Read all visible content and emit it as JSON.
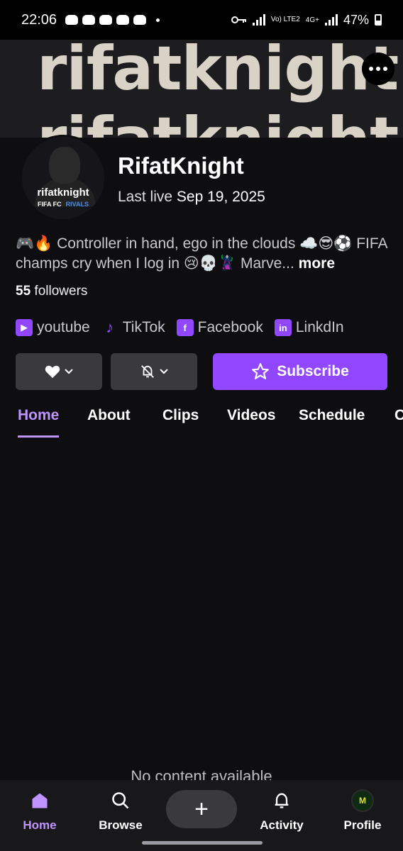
{
  "status_bar": {
    "time": "22:06",
    "network": "Vo) LTE2",
    "network2": "4G+",
    "battery": "47%"
  },
  "banner": {
    "text_top": "rifatknight",
    "text_bottom": "rifatknight"
  },
  "avatar": {
    "name": "rifatknight",
    "tag1": "FIFA FC",
    "tag2": "RIVALS"
  },
  "channel": {
    "name": "RifatKnight",
    "last_live_label": "Last live",
    "last_live_date": "Sep 19, 2025",
    "bio": "🎮🔥 Controller in hand, ego in the clouds ☁️😎⚽ FIFA champs cry when I log in 😢💀🦹 Marve...",
    "bio_more": "more",
    "followers_count": "55",
    "followers_label": "followers"
  },
  "socials": [
    {
      "label": "youtube",
      "icon": "youtube-icon"
    },
    {
      "label": "TikTok",
      "icon": "tiktok-icon"
    },
    {
      "label": "Facebook",
      "icon": "facebook-icon"
    },
    {
      "label": "LinkdIn",
      "icon": "linkedin-icon"
    }
  ],
  "actions": {
    "subscribe_label": "Subscribe"
  },
  "tabs": [
    {
      "label": "Home",
      "active": true
    },
    {
      "label": "About"
    },
    {
      "label": "Clips"
    },
    {
      "label": "Videos"
    },
    {
      "label": "Schedule"
    },
    {
      "label": "C"
    }
  ],
  "empty_text": "No content available",
  "bottom_nav": {
    "home": "Home",
    "browse": "Browse",
    "activity": "Activity",
    "profile": "Profile",
    "create_symbol": "+"
  },
  "colors": {
    "accent": "#9147ff",
    "accent_light": "#bf94ff",
    "background": "#0e0e10"
  }
}
